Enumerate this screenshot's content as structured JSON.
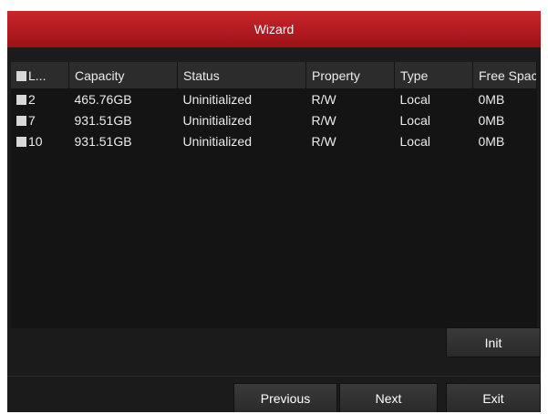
{
  "window": {
    "title": "Wizard"
  },
  "table": {
    "headers": [
      "L...",
      "Capacity",
      "Status",
      "Property",
      "Type",
      "Free Space"
    ],
    "rows": [
      {
        "label": "2",
        "capacity": "465.76GB",
        "status": "Uninitialized",
        "property": "R/W",
        "type": "Local",
        "free_space": "0MB"
      },
      {
        "label": "7",
        "capacity": "931.51GB",
        "status": "Uninitialized",
        "property": "R/W",
        "type": "Local",
        "free_space": "0MB"
      },
      {
        "label": "10",
        "capacity": "931.51GB",
        "status": "Uninitialized",
        "property": "R/W",
        "type": "Local",
        "free_space": "0MB"
      }
    ]
  },
  "buttons": {
    "init": "Init",
    "previous": "Previous",
    "next": "Next",
    "exit": "Exit"
  },
  "colors": {
    "title_bar": "#b01a20",
    "panel": "#1b1b1b"
  }
}
